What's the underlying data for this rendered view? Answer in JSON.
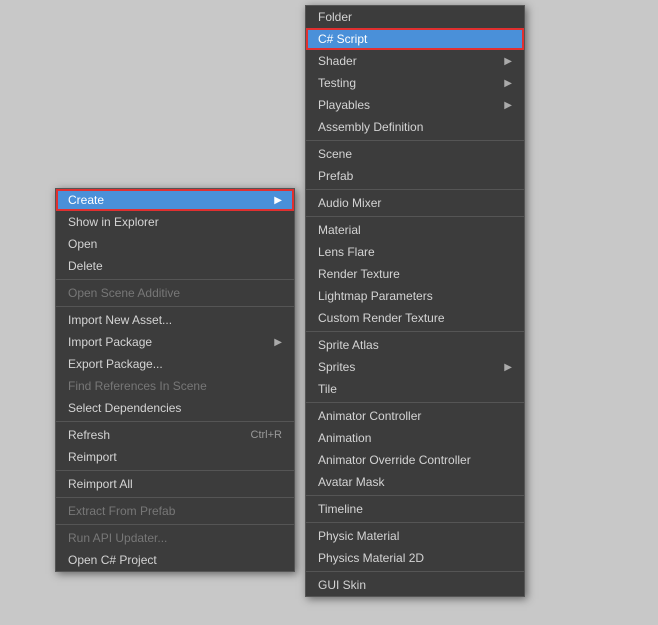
{
  "background": {
    "color": "#c8c8c8"
  },
  "leftMenu": {
    "items": [
      {
        "id": "create",
        "label": "Create",
        "hasArrow": true,
        "disabled": false,
        "highlighted": true,
        "separator_before": false
      },
      {
        "id": "show-in-explorer",
        "label": "Show in Explorer",
        "hasArrow": false,
        "disabled": false,
        "highlighted": false,
        "separator_before": false
      },
      {
        "id": "open",
        "label": "Open",
        "hasArrow": false,
        "disabled": false,
        "highlighted": false,
        "separator_before": false
      },
      {
        "id": "delete",
        "label": "Delete",
        "hasArrow": false,
        "disabled": false,
        "highlighted": false,
        "separator_before": false
      },
      {
        "id": "open-scene-additive",
        "label": "Open Scene Additive",
        "hasArrow": false,
        "disabled": true,
        "highlighted": false,
        "separator_before": true
      },
      {
        "id": "import-new-asset",
        "label": "Import New Asset...",
        "hasArrow": false,
        "disabled": false,
        "highlighted": false,
        "separator_before": true
      },
      {
        "id": "import-package",
        "label": "Import Package",
        "hasArrow": true,
        "disabled": false,
        "highlighted": false,
        "separator_before": false
      },
      {
        "id": "export-package",
        "label": "Export Package...",
        "hasArrow": false,
        "disabled": false,
        "highlighted": false,
        "separator_before": false
      },
      {
        "id": "find-references",
        "label": "Find References In Scene",
        "hasArrow": false,
        "disabled": true,
        "highlighted": false,
        "separator_before": false
      },
      {
        "id": "select-dependencies",
        "label": "Select Dependencies",
        "hasArrow": false,
        "disabled": false,
        "highlighted": false,
        "separator_before": false
      },
      {
        "id": "refresh",
        "label": "Refresh",
        "shortcut": "Ctrl+R",
        "hasArrow": false,
        "disabled": false,
        "highlighted": false,
        "separator_before": true
      },
      {
        "id": "reimport",
        "label": "Reimport",
        "hasArrow": false,
        "disabled": false,
        "highlighted": false,
        "separator_before": false
      },
      {
        "id": "reimport-all",
        "label": "Reimport All",
        "hasArrow": false,
        "disabled": false,
        "highlighted": false,
        "separator_before": true
      },
      {
        "id": "extract-from-prefab",
        "label": "Extract From Prefab",
        "hasArrow": false,
        "disabled": true,
        "highlighted": false,
        "separator_before": true
      },
      {
        "id": "run-api-updater",
        "label": "Run API Updater...",
        "hasArrow": false,
        "disabled": true,
        "highlighted": false,
        "separator_before": true
      },
      {
        "id": "open-csharp-project",
        "label": "Open C# Project",
        "hasArrow": false,
        "disabled": false,
        "highlighted": false,
        "separator_before": false
      }
    ]
  },
  "rightMenu": {
    "items": [
      {
        "id": "folder",
        "label": "Folder",
        "hasArrow": false,
        "disabled": false,
        "highlighted": false,
        "separator_before": false
      },
      {
        "id": "csharp-script",
        "label": "C# Script",
        "hasArrow": false,
        "disabled": false,
        "highlighted": true,
        "separator_before": false
      },
      {
        "id": "shader",
        "label": "Shader",
        "hasArrow": true,
        "disabled": false,
        "highlighted": false,
        "separator_before": false
      },
      {
        "id": "testing",
        "label": "Testing",
        "hasArrow": true,
        "disabled": false,
        "highlighted": false,
        "separator_before": false
      },
      {
        "id": "playables",
        "label": "Playables",
        "hasArrow": true,
        "disabled": false,
        "highlighted": false,
        "separator_before": false
      },
      {
        "id": "assembly-definition",
        "label": "Assembly Definition",
        "hasArrow": false,
        "disabled": false,
        "highlighted": false,
        "separator_before": false
      },
      {
        "id": "scene",
        "label": "Scene",
        "hasArrow": false,
        "disabled": false,
        "highlighted": false,
        "separator_before": true
      },
      {
        "id": "prefab",
        "label": "Prefab",
        "hasArrow": false,
        "disabled": false,
        "highlighted": false,
        "separator_before": false
      },
      {
        "id": "audio-mixer",
        "label": "Audio Mixer",
        "hasArrow": false,
        "disabled": false,
        "highlighted": false,
        "separator_before": true
      },
      {
        "id": "material",
        "label": "Material",
        "hasArrow": false,
        "disabled": false,
        "highlighted": false,
        "separator_before": true
      },
      {
        "id": "lens-flare",
        "label": "Lens Flare",
        "hasArrow": false,
        "disabled": false,
        "highlighted": false,
        "separator_before": false
      },
      {
        "id": "render-texture",
        "label": "Render Texture",
        "hasArrow": false,
        "disabled": false,
        "highlighted": false,
        "separator_before": false
      },
      {
        "id": "lightmap-parameters",
        "label": "Lightmap Parameters",
        "hasArrow": false,
        "disabled": false,
        "highlighted": false,
        "separator_before": false
      },
      {
        "id": "custom-render-texture",
        "label": "Custom Render Texture",
        "hasArrow": false,
        "disabled": false,
        "highlighted": false,
        "separator_before": false
      },
      {
        "id": "sprite-atlas",
        "label": "Sprite Atlas",
        "hasArrow": false,
        "disabled": false,
        "highlighted": false,
        "separator_before": true
      },
      {
        "id": "sprites",
        "label": "Sprites",
        "hasArrow": true,
        "disabled": false,
        "highlighted": false,
        "separator_before": false
      },
      {
        "id": "tile",
        "label": "Tile",
        "hasArrow": false,
        "disabled": false,
        "highlighted": false,
        "separator_before": false
      },
      {
        "id": "animator-controller",
        "label": "Animator Controller",
        "hasArrow": false,
        "disabled": false,
        "highlighted": false,
        "separator_before": true
      },
      {
        "id": "animation",
        "label": "Animation",
        "hasArrow": false,
        "disabled": false,
        "highlighted": false,
        "separator_before": false
      },
      {
        "id": "animator-override-controller",
        "label": "Animator Override Controller",
        "hasArrow": false,
        "disabled": false,
        "highlighted": false,
        "separator_before": false
      },
      {
        "id": "avatar-mask",
        "label": "Avatar Mask",
        "hasArrow": false,
        "disabled": false,
        "highlighted": false,
        "separator_before": false
      },
      {
        "id": "timeline",
        "label": "Timeline",
        "hasArrow": false,
        "disabled": false,
        "highlighted": false,
        "separator_before": true
      },
      {
        "id": "physic-material",
        "label": "Physic Material",
        "hasArrow": false,
        "disabled": false,
        "highlighted": false,
        "separator_before": true
      },
      {
        "id": "physics-material-2d",
        "label": "Physics Material 2D",
        "hasArrow": false,
        "disabled": false,
        "highlighted": false,
        "separator_before": false
      },
      {
        "id": "gui-skin",
        "label": "GUI Skin",
        "hasArrow": false,
        "disabled": false,
        "highlighted": false,
        "separator_before": true
      }
    ]
  }
}
